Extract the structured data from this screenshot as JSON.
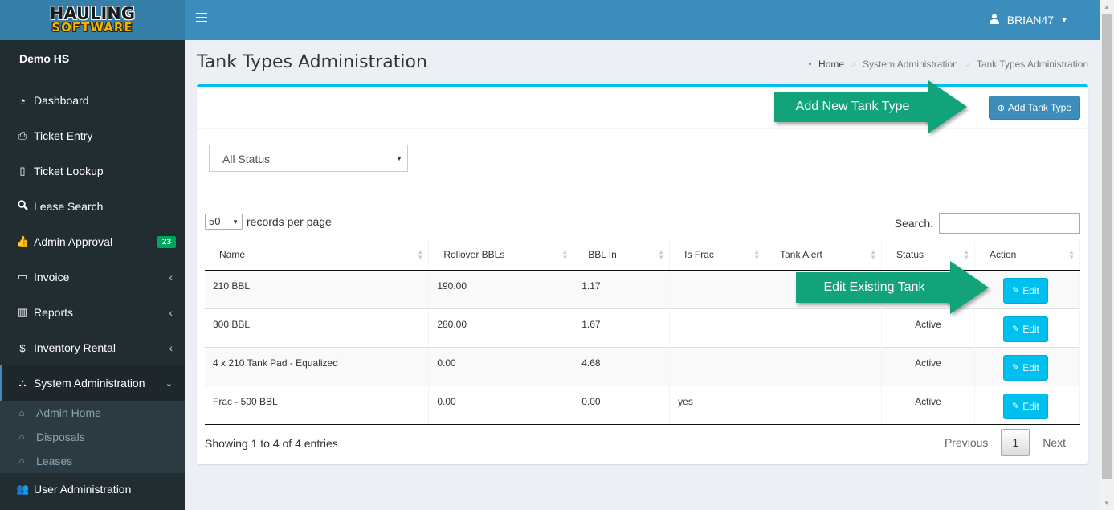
{
  "logo": {
    "line1": "HAULING",
    "line2": "SOFTWARE"
  },
  "company": "Demo HS",
  "sidebar": {
    "items": [
      {
        "label": "Dashboard",
        "icon": "dashboard-icon"
      },
      {
        "label": "Ticket Entry",
        "icon": "print-icon"
      },
      {
        "label": "Ticket Lookup",
        "icon": "file-icon"
      },
      {
        "label": "Lease Search",
        "icon": "search-icon"
      },
      {
        "label": "Admin Approval",
        "icon": "thumbs-up-icon",
        "badge": "23"
      },
      {
        "label": "Invoice",
        "icon": "credit-card-icon"
      },
      {
        "label": "Reports",
        "icon": "bar-chart-icon"
      },
      {
        "label": "Inventory Rental",
        "icon": "dollar-icon"
      },
      {
        "label": "System Administration",
        "icon": "sitemap-icon"
      },
      {
        "label": "User Administration",
        "icon": "users-icon"
      }
    ],
    "sub_items": [
      {
        "label": "Admin Home",
        "icon": "home-icon"
      },
      {
        "label": "Disposals",
        "icon": "circle-icon"
      },
      {
        "label": "Leases",
        "icon": "circle-icon"
      }
    ]
  },
  "header": {
    "user": "BRIAN47"
  },
  "page": {
    "title": "Tank Types Administration"
  },
  "breadcrumb": {
    "home": "Home",
    "level2": "System Administration",
    "level3": "Tank Types Administration"
  },
  "toolbar": {
    "add_label": "Add Tank Type"
  },
  "filter": {
    "status_value": "All Status"
  },
  "table_controls": {
    "length_value": "50",
    "length_suffix": "records per page",
    "search_label": "Search:"
  },
  "table": {
    "columns": [
      "Name",
      "Rollover BBLs",
      "BBL In",
      "Is Frac",
      "Tank Alert",
      "Status",
      "Action"
    ],
    "rows": [
      {
        "name": "210 BBL",
        "rollover": "190.00",
        "bbl_in": "1.17",
        "is_frac": "",
        "tank_alert": "",
        "status": ""
      },
      {
        "name": "300 BBL",
        "rollover": "280.00",
        "bbl_in": "1.67",
        "is_frac": "",
        "tank_alert": "",
        "status": "Active"
      },
      {
        "name": "4 x 210 Tank Pad - Equalized",
        "rollover": "0.00",
        "bbl_in": "4.68",
        "is_frac": "",
        "tank_alert": "",
        "status": "Active"
      },
      {
        "name": "Frac - 500 BBL",
        "rollover": "0.00",
        "bbl_in": "0.00",
        "is_frac": "yes",
        "tank_alert": "",
        "status": "Active"
      }
    ],
    "edit_label": "Edit"
  },
  "footer": {
    "info": "Showing 1 to 4 of 4 entries",
    "previous": "Previous",
    "current_page": "1",
    "next": "Next"
  },
  "callouts": {
    "add": "Add New Tank Type",
    "edit": "Edit Existing Tank"
  },
  "colors": {
    "sidebar": "#222d32",
    "header": "#3c8dbc",
    "accent": "#00c0ef",
    "callout": "#13a37a",
    "badge": "#00a65a"
  }
}
